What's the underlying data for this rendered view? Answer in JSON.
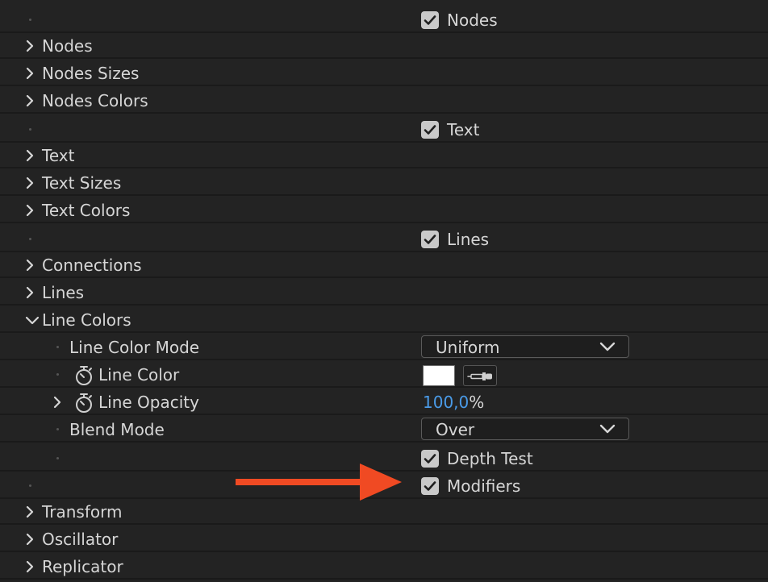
{
  "rows": {
    "nodes_toggle": {
      "label": "Nodes",
      "checked": true
    },
    "nodes": {
      "label": "Nodes"
    },
    "nodes_sizes": {
      "label": "Nodes Sizes"
    },
    "nodes_colors": {
      "label": "Nodes Colors"
    },
    "text_toggle": {
      "label": "Text",
      "checked": true
    },
    "text": {
      "label": "Text"
    },
    "text_sizes": {
      "label": "Text Sizes"
    },
    "text_colors": {
      "label": "Text Colors"
    },
    "lines_toggle": {
      "label": "Lines",
      "checked": true
    },
    "connections": {
      "label": "Connections"
    },
    "lines": {
      "label": "Lines"
    },
    "line_colors": {
      "label": "Line Colors",
      "expanded": true
    },
    "line_color_mode": {
      "label": "Line Color Mode",
      "value": "Uniform"
    },
    "line_color": {
      "label": "Line Color",
      "color": "#ffffff"
    },
    "line_opacity": {
      "label": "Line Opacity",
      "value": "100,0",
      "unit": "%"
    },
    "blend_mode": {
      "label": "Blend Mode",
      "value": "Over"
    },
    "depth_test": {
      "label": "Depth Test",
      "checked": true
    },
    "modifiers": {
      "label": "Modifiers",
      "checked": true
    },
    "transform": {
      "label": "Transform"
    },
    "oscillator": {
      "label": "Oscillator"
    },
    "replicator": {
      "label": "Replicator"
    }
  },
  "icons": {
    "expand": "chevron-right-icon",
    "collapse": "chevron-down-icon",
    "stopwatch": "stopwatch-icon",
    "eyedropper": "eyedropper-icon",
    "checkmark": "checkmark-icon",
    "annotation": "arrow-right-icon"
  },
  "colors": {
    "background": "#232323",
    "row_divider": "#1a1a1a",
    "text": "#d6d6d6",
    "value_blue": "#4a9be8",
    "checkbox": "#c9c9c9",
    "annotation_arrow": "#f04a23"
  }
}
